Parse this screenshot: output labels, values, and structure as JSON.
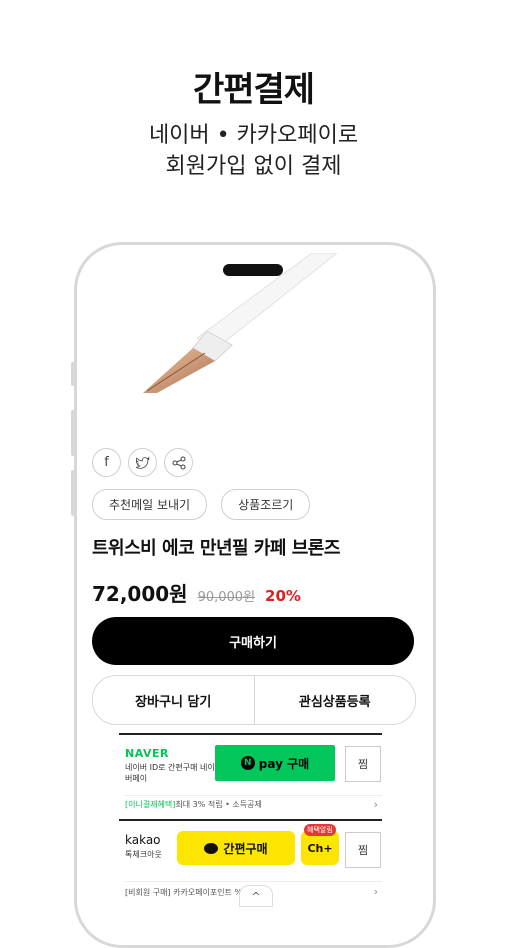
{
  "hero": {
    "title": "간편결제",
    "subtitle_line1": "네이버 • 카카오페이로",
    "subtitle_line2": "회원가입 없이 결제"
  },
  "product": {
    "title": "트위스비 에코 만년필 카페 브론즈",
    "price": "72,000원",
    "original_price": "90,000원",
    "discount": "20%"
  },
  "actions": {
    "recommend_email": "추천메일 보내기",
    "product_inquiry": "상품조르기",
    "buy": "구매하기",
    "cart": "장바구니 담기",
    "wishlist": "관심상품등록"
  },
  "npay": {
    "logo": "NAVER",
    "desc": "네이버 ID로 간편구매 네이버페이",
    "button_label": "pay 구매",
    "n_mark": "N",
    "jjim": "찜",
    "benefit_tag": "[이니결제혜택]",
    "benefit_text": "최대 3% 적립 • 소득공제"
  },
  "kakao": {
    "logo": "kakao",
    "desc": "톡체크아웃",
    "button_label": "간편구매",
    "plus_label": "Ch+",
    "plus_badge": "혜택알림",
    "jjim": "찜",
    "benefit_text": "[비회원 구매] 카카오페이포인트 % 적립"
  },
  "icons": {
    "facebook": "f",
    "twitter": "🐦",
    "share": "⋖",
    "chevron": "›",
    "up": "^"
  }
}
